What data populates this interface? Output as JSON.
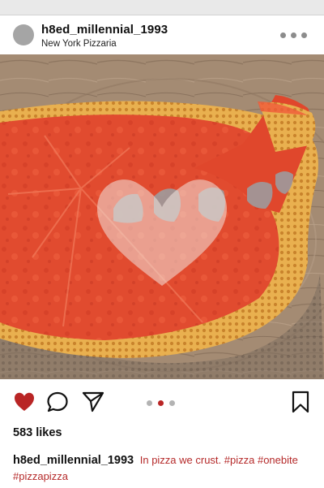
{
  "post": {
    "username": "h8ed_millennial_1993",
    "location": "New York Pizzaria",
    "likes": "583 likes",
    "caption_user": "h8ed_millennial_1993",
    "caption_text": "In pizza we crust. #pizza #onebite #pizzapizza"
  },
  "icons": {
    "more": "more-options-icon",
    "like": "heart-icon",
    "comment": "comment-icon",
    "share": "send-icon",
    "save": "bookmark-icon"
  },
  "carousel": {
    "count": 3,
    "active": 2
  },
  "colors": {
    "accent": "#b92525",
    "pizza": "#e24a2e",
    "crust": "#e0a23e",
    "board": "#a88f76"
  }
}
